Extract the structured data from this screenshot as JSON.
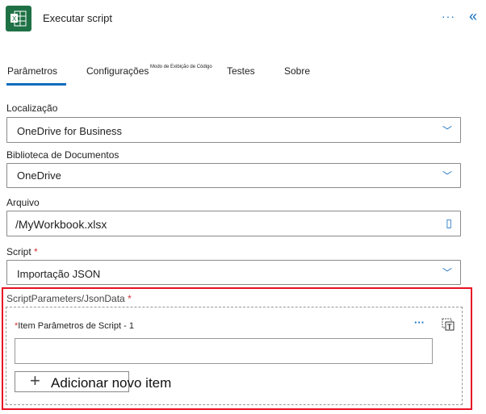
{
  "header": {
    "title": "Executar script",
    "more_label": "···",
    "collapse_label": "«"
  },
  "tabs": [
    {
      "label": "Parâmetros"
    },
    {
      "label": "Configurações"
    },
    {
      "label": "Modo de Exibição de Código"
    },
    {
      "label": "Testes"
    },
    {
      "label": "Sobre"
    }
  ],
  "fields": {
    "location": {
      "label": "Localização",
      "value": "OneDrive for Business"
    },
    "library": {
      "label": "Biblioteca de Documentos",
      "value": "OneDrive"
    },
    "file": {
      "label": "Arquivo",
      "value": "/MyWorkbook.xlsx"
    },
    "script": {
      "label": "Script",
      "required": "*",
      "value": "Importação JSON"
    }
  },
  "params": {
    "label": "ScriptParameters/JsonData",
    "required": "*",
    "item_label": "Item Parâmetros de Script - 1",
    "item_required": "*",
    "item_value": "",
    "more_label": "···",
    "add_label": "Adicionar novo item",
    "add_icon": "+"
  },
  "colors": {
    "accent": "#0f6cbd",
    "highlight": "#e81123",
    "excel": "#1e7145"
  }
}
